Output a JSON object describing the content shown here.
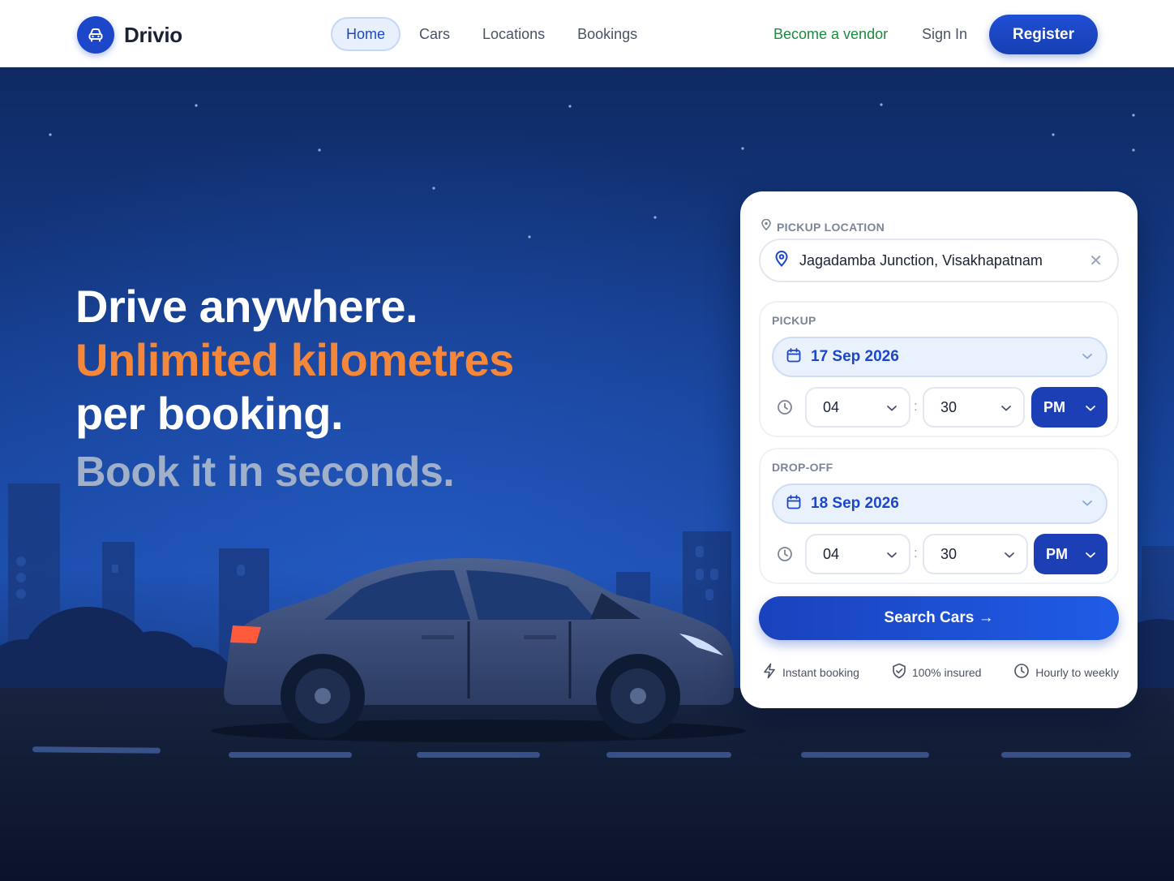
{
  "nav": {
    "brand": "Drivio",
    "links": [
      "Home",
      "Cars",
      "Locations",
      "Bookings"
    ],
    "active_link": "Home",
    "vendor": "Become a vendor",
    "signin": "Sign In",
    "register": "Register"
  },
  "hero": {
    "line1": "Drive anywhere.",
    "line2": "Unlimited kilometres",
    "line3": "per booking.",
    "line4": "Book it in seconds."
  },
  "search": {
    "pickup_location_label": "PICKUP LOCATION",
    "location_value": "Jagadamba Junction, Visakhapatnam",
    "pickup": {
      "label": "PICKUP",
      "date": "17 Sep 2026",
      "hour": "04",
      "minute": "30",
      "ampm": "PM"
    },
    "dropoff": {
      "label": "DROP-OFF",
      "date": "18 Sep 2026",
      "hour": "04",
      "minute": "30",
      "ampm": "PM"
    },
    "time_separator": ":",
    "button": "Search Cars →",
    "features": [
      "Instant booking",
      "100% insured",
      "Hourly to weekly"
    ]
  },
  "icons": {
    "brand": "car-icon",
    "location": "map-pin-icon",
    "clear": "close-icon",
    "date": "calendar-icon",
    "time": "clock-icon",
    "dropdown": "chevron-down-icon",
    "instant": "lightning-icon",
    "insured": "shield-check-icon",
    "hourly": "clock-icon"
  },
  "colors": {
    "brand_blue": "#1d47c9",
    "accent_orange": "#f5873a",
    "vendor_green": "#1a8a3e",
    "hero_bg": "#163f91"
  }
}
